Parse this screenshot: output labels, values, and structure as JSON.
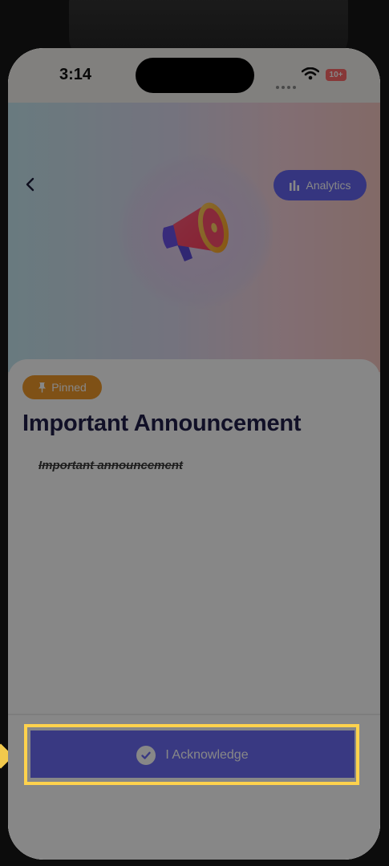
{
  "status_bar": {
    "time": "3:14",
    "battery": "10+",
    "icons": [
      "signal-dots-icon",
      "wifi-icon",
      "battery-icon"
    ]
  },
  "header": {
    "back_icon": "chevron-left-icon",
    "analytics_label": "Analytics",
    "analytics_icon": "bar-chart-icon",
    "hero_icon": "megaphone-icon"
  },
  "announcement": {
    "badge_label": "Pinned",
    "badge_icon": "pin-icon",
    "title": "Important Announcement",
    "body": "Important announcement"
  },
  "footer": {
    "acknowledge_label": "I Acknowledge",
    "acknowledge_icon": "check-circle-icon"
  },
  "colors": {
    "accent": "#6c6cf6",
    "badge": "#f09a2a",
    "title": "#201f4b",
    "highlight": "#ffd24d"
  }
}
